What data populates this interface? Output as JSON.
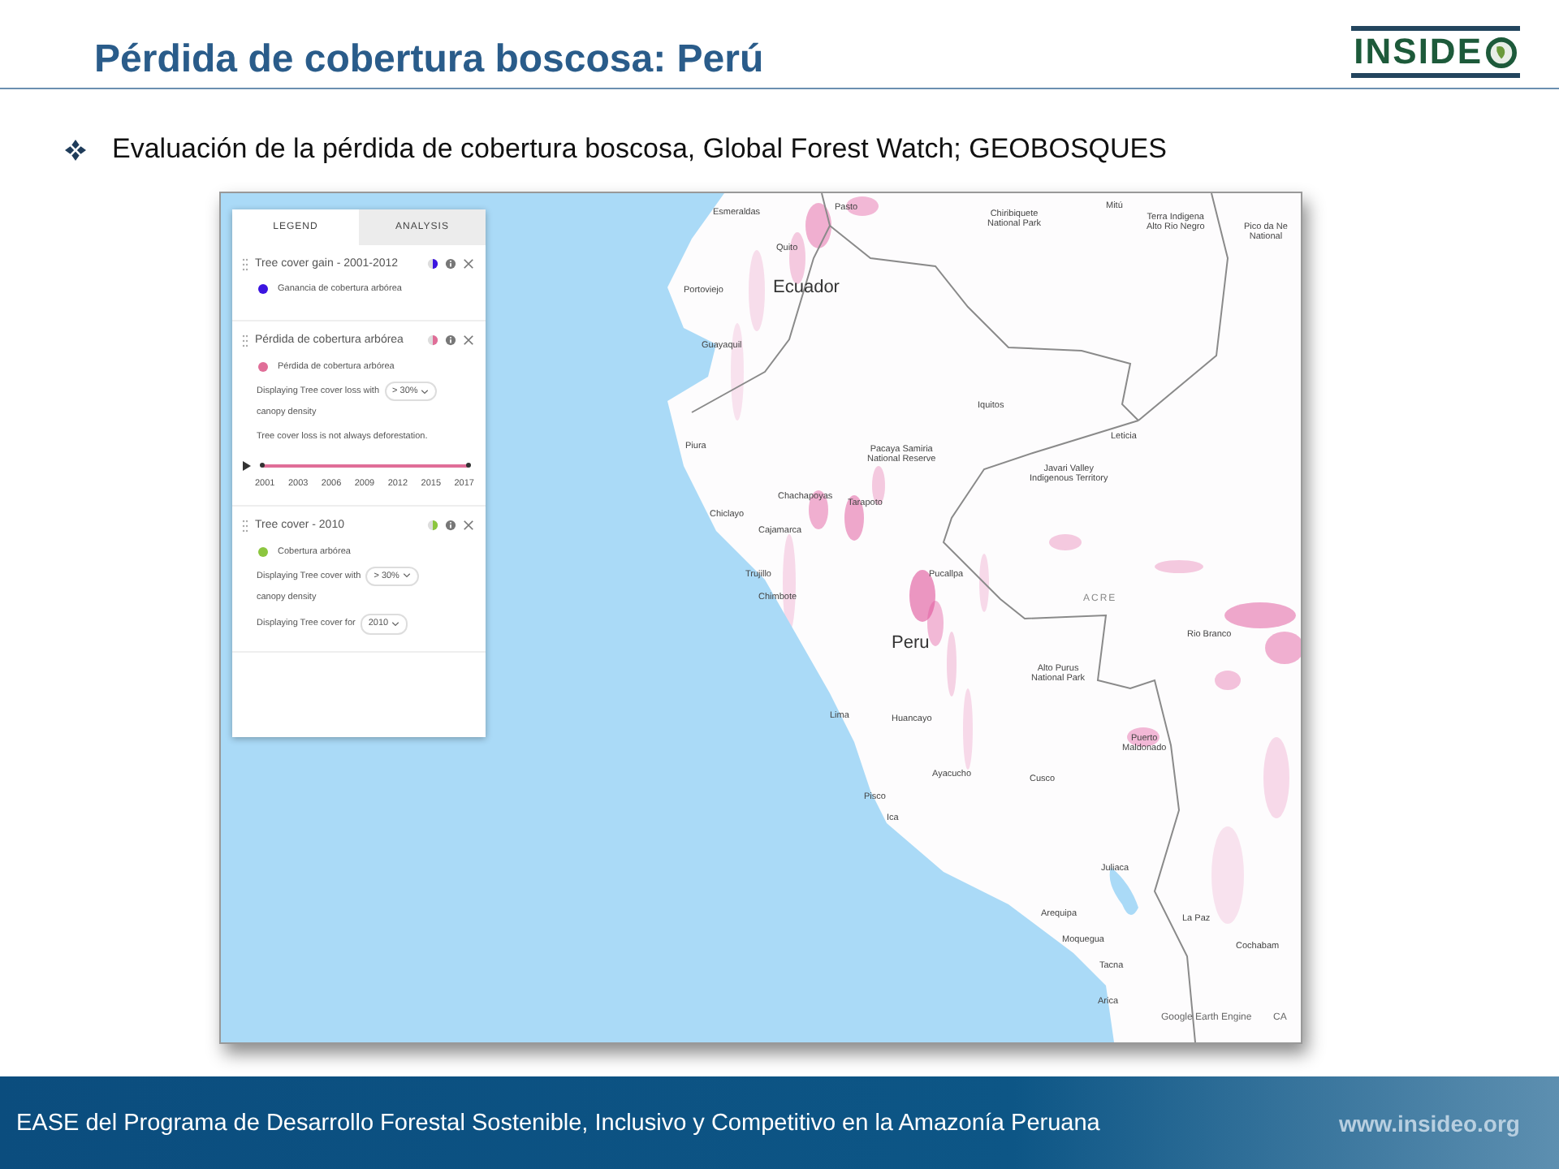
{
  "slide": {
    "title": "Pérdida de cobertura boscosa: Perú",
    "logo": "INSIDE",
    "bullet": "Evaluación de la pérdida de cobertura boscosa, Global Forest Watch; GEOBOSQUES"
  },
  "legend_panel": {
    "tabs": [
      {
        "label": "LEGEND",
        "selected": true
      },
      {
        "label": "ANALYSIS",
        "selected": false
      }
    ],
    "layers": [
      {
        "title": "Tree cover gain - 2001-2012",
        "color": "#3b14e0",
        "item": "Ganancia de cobertura arbórea"
      },
      {
        "title": "Pérdida de cobertura arbórea",
        "color": "#e06e98",
        "item": "Pérdida de cobertura arbórea",
        "options": [
          {
            "kind": "select",
            "before": "Displaying Tree cover loss with",
            "value": "> 30%",
            "after": "canopy density"
          },
          {
            "kind": "note",
            "text": "Tree cover loss is not always deforestation."
          },
          {
            "kind": "timeline",
            "level": 1,
            "years": [
              "2001",
              "2003",
              "2006",
              "2009",
              "2012",
              "2015",
              "2017"
            ]
          }
        ]
      },
      {
        "title": "Tree cover - 2010",
        "color": "#8cc63f",
        "item": "Cobertura arbórea",
        "options": [
          {
            "kind": "select",
            "before": "Displaying Tree cover with",
            "value": "> 30%",
            "after": "canopy density"
          },
          {
            "kind": "select",
            "before": "Displaying Tree cover for",
            "value": "2010"
          }
        ]
      }
    ]
  },
  "map": {
    "labels": [
      {
        "kind": "city",
        "lines": [
          "Esmeraldas"
        ]
      },
      {
        "kind": "city",
        "lines": [
          "Pasto"
        ]
      },
      {
        "kind": "city",
        "lines": [
          "Quito"
        ]
      },
      {
        "kind": "city",
        "lines": [
          "Portoviejo"
        ]
      },
      {
        "kind": "country",
        "lines": [
          "Ecuador"
        ]
      },
      {
        "kind": "city",
        "lines": [
          "Guayaquil"
        ]
      },
      {
        "kind": "city",
        "lines": [
          "Chiribiquete",
          "National Park"
        ]
      },
      {
        "kind": "city",
        "lines": [
          "Mitú"
        ]
      },
      {
        "kind": "city",
        "lines": [
          "Terra Indigena",
          "Alto Rio Negro"
        ]
      },
      {
        "kind": "city",
        "lines": [
          "Pico da Ne",
          "National"
        ]
      },
      {
        "kind": "city",
        "lines": [
          "Iquitos"
        ]
      },
      {
        "kind": "city",
        "lines": [
          "Leticia"
        ]
      },
      {
        "kind": "city",
        "lines": [
          "Piura"
        ]
      },
      {
        "kind": "city",
        "lines": [
          "Pacaya Samiria",
          "National Reserve"
        ]
      },
      {
        "kind": "city",
        "lines": [
          "Javari Valley",
          "Indigenous Territory"
        ]
      },
      {
        "kind": "city",
        "lines": [
          "Chachapoyas"
        ]
      },
      {
        "kind": "city",
        "lines": [
          "Tarapoto"
        ]
      },
      {
        "kind": "city",
        "lines": [
          "Chiclayo"
        ]
      },
      {
        "kind": "city",
        "lines": [
          "Cajamarca"
        ]
      },
      {
        "kind": "city",
        "lines": [
          "Trujillo"
        ]
      },
      {
        "kind": "city",
        "lines": [
          "Chimbote"
        ]
      },
      {
        "kind": "city",
        "lines": [
          "Pucallpa"
        ]
      },
      {
        "kind": "region",
        "lines": [
          "ACRE"
        ]
      },
      {
        "kind": "country",
        "lines": [
          "Peru"
        ]
      },
      {
        "kind": "city",
        "lines": [
          "Rio Branco"
        ]
      },
      {
        "kind": "city",
        "lines": [
          "Alto Purus",
          "National Park"
        ]
      },
      {
        "kind": "city",
        "lines": [
          "Lima"
        ]
      },
      {
        "kind": "city",
        "lines": [
          "Huancayo"
        ]
      },
      {
        "kind": "city",
        "lines": [
          "Puerto",
          "Maldonado"
        ]
      },
      {
        "kind": "city",
        "lines": [
          "Ayacucho"
        ]
      },
      {
        "kind": "city",
        "lines": [
          "Cusco"
        ]
      },
      {
        "kind": "city",
        "lines": [
          "Pisco"
        ]
      },
      {
        "kind": "city",
        "lines": [
          "Ica"
        ]
      },
      {
        "kind": "city",
        "lines": [
          "Juliaca"
        ]
      },
      {
        "kind": "city",
        "lines": [
          "Arequipa"
        ]
      },
      {
        "kind": "city",
        "lines": [
          "La Paz"
        ]
      },
      {
        "kind": "city",
        "lines": [
          "Moquegua"
        ]
      },
      {
        "kind": "city",
        "lines": [
          "Cochabam"
        ]
      },
      {
        "kind": "city",
        "lines": [
          "Tacna"
        ]
      },
      {
        "kind": "city",
        "lines": [
          "Arica"
        ]
      },
      {
        "kind": "credit",
        "lines": [
          "Google Earth Engine"
        ]
      },
      {
        "kind": "credit",
        "lines": [
          "CA"
        ]
      }
    ]
  },
  "footer": {
    "text": "EASE del Programa de Desarrollo Forestal Sostenible, Inclusivo y Competitivo en la Amazonía Peruana",
    "url": "www.insideo.org"
  }
}
